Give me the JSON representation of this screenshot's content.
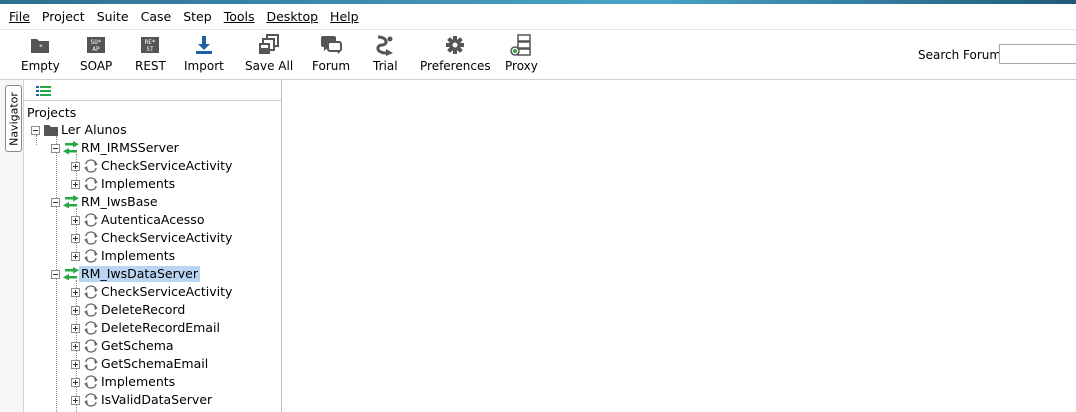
{
  "menu": [
    "File",
    "Project",
    "Suite",
    "Case",
    "Step",
    "Tools",
    "Desktop",
    "Help"
  ],
  "toolbar": {
    "empty": "Empty",
    "soap": "SOAP",
    "rest": "REST",
    "import": "Import",
    "save_all": "Save All",
    "forum": "Forum",
    "trial": "Trial",
    "preferences": "Preferences",
    "proxy": "Proxy"
  },
  "search": {
    "label": "Search Forum",
    "value": ""
  },
  "navigator": {
    "tab_label": "Navigator"
  },
  "tree": {
    "root_label": "Projects",
    "project": "Ler Alunos",
    "services": [
      {
        "name": "RM_IRMSServer",
        "operations": [
          "CheckServiceActivity",
          "Implements"
        ]
      },
      {
        "name": "RM_IwsBase",
        "operations": [
          "AutenticaAcesso",
          "CheckServiceActivity",
          "Implements"
        ]
      },
      {
        "name": "RM_IwsDataServer",
        "operations": [
          "CheckServiceActivity",
          "DeleteRecord",
          "DeleteRecordEmail",
          "GetSchema",
          "GetSchemaEmail",
          "Implements",
          "IsValidDataServer"
        ]
      }
    ]
  },
  "colors": {
    "service_icon": "#27a844",
    "selection": "#b9d5f2",
    "toolbar_icon": "#555555",
    "import_icon": "#1f5fa8"
  }
}
